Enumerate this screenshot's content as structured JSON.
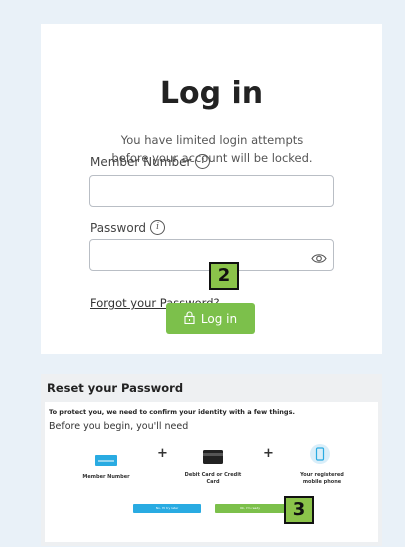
{
  "login": {
    "title": "Log in",
    "notice": "You have limited login attempts before your account will be locked.",
    "member_label": "Member Number",
    "member_value": "",
    "password_label": "Password",
    "password_value": "",
    "info_glyph": "i",
    "forgot_link": "Forgot your Password?",
    "login_button": "Log in"
  },
  "badges": {
    "forgot": "2",
    "ready": "3"
  },
  "reset": {
    "title": "Reset your Password",
    "protect_text": "To protect you, we need to confirm your identity with a few things.",
    "before_text": "Before you begin, you'll need",
    "items": [
      {
        "label": "Member Number",
        "icon": "card-icon"
      },
      {
        "label": "Debit Card or Credit Card",
        "icon": "debit-card-icon"
      },
      {
        "label": "Your registered mobile phone",
        "icon": "phone-icon"
      }
    ],
    "plus": "+",
    "not_ready_button": "No, I'll try later",
    "ready_button": "Ok, I'm ready"
  },
  "colors": {
    "accent": "#7cc04b",
    "blue": "#29abe2",
    "badge": "#8bc34a"
  }
}
